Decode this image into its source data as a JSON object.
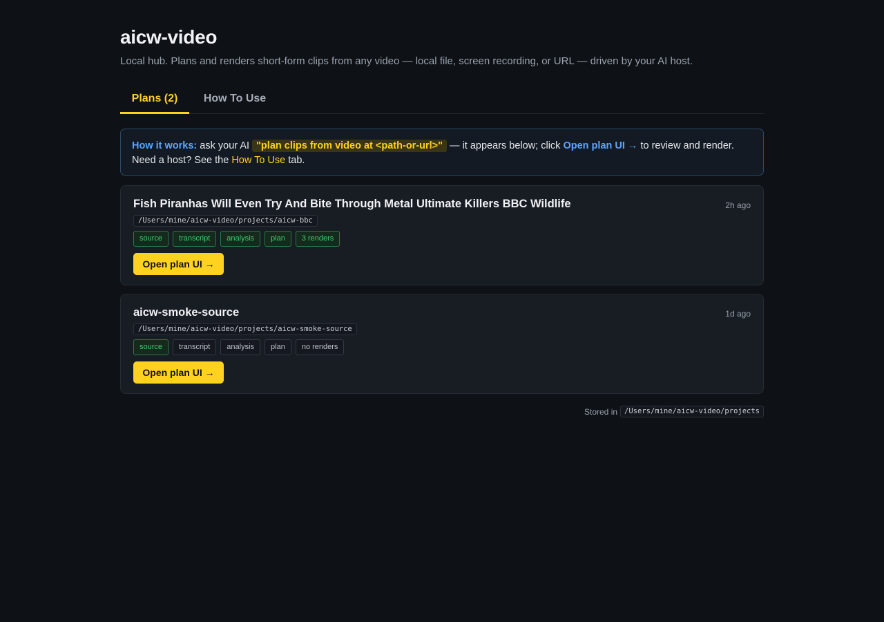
{
  "header": {
    "title": "aicw-video",
    "subtitle": "Local hub. Plans and renders short-form clips from any video — local file, screen recording, or URL — driven by your AI host."
  },
  "tabs": [
    {
      "label": "Plans (2)",
      "active": true
    },
    {
      "label": "How To Use",
      "active": false
    }
  ],
  "info": {
    "lead": "How it works:",
    "text1": " ask your AI ",
    "command": "\"plan clips from video at <path-or-url>\"",
    "text2": " — it appears below; click ",
    "open_link": "Open plan UI →",
    "text3": " to review and render. Need a host? See the ",
    "howto_link": "How To Use",
    "text4": " tab."
  },
  "plans": [
    {
      "title": "Fish Piranhas Will Even Try And Bite Through Metal Ultimate Killers BBC Wildlife",
      "time": "2h ago",
      "path": "/Users/mine/aicw-video/projects/aicw-bbc",
      "badges": [
        {
          "label": "source",
          "done": true
        },
        {
          "label": "transcript",
          "done": true
        },
        {
          "label": "analysis",
          "done": true
        },
        {
          "label": "plan",
          "done": true
        },
        {
          "label": "3 renders",
          "done": true
        }
      ],
      "button": "Open plan UI →"
    },
    {
      "title": "aicw-smoke-source",
      "time": "1d ago",
      "path": "/Users/mine/aicw-video/projects/aicw-smoke-source",
      "badges": [
        {
          "label": "source",
          "done": true
        },
        {
          "label": "transcript",
          "done": false
        },
        {
          "label": "analysis",
          "done": false
        },
        {
          "label": "plan",
          "done": false
        },
        {
          "label": "no renders",
          "done": false
        }
      ],
      "button": "Open plan UI →"
    }
  ],
  "footer": {
    "label": "Stored in",
    "path": "/Users/mine/aicw-video/projects"
  },
  "colors": {
    "accent": "#ffd21f",
    "link": "#5aa6ff",
    "done": "#3ecf6e",
    "background": "#0e1116"
  }
}
